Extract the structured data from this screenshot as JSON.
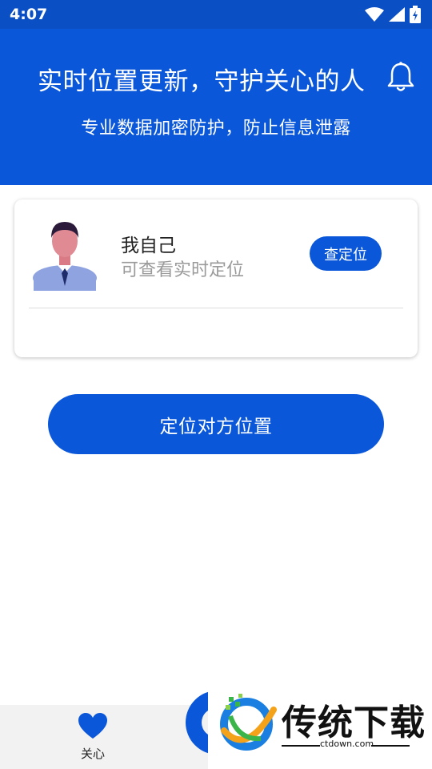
{
  "status_bar": {
    "time": "4:07",
    "icons": [
      "wifi-icon",
      "signal-icon",
      "battery-charging-icon"
    ]
  },
  "header": {
    "title": "实时位置更新，守护关心的人",
    "subtitle": "专业数据加密防护，防止信息泄露",
    "bell_icon": "bell-icon"
  },
  "card": {
    "name": "我自己",
    "description": "可查看实时定位",
    "locate_button": "查定位"
  },
  "main_button": "定位对方位置",
  "bottom_nav": {
    "items": [
      {
        "label": "关心",
        "icon": "heart-icon"
      }
    ]
  },
  "watermark": {
    "brand": "传统下载",
    "url": "ctdown.com"
  },
  "colors": {
    "primary": "#0a57d9",
    "status_bar": "#0a4fc4",
    "nav_background": "#f2f2f2"
  }
}
